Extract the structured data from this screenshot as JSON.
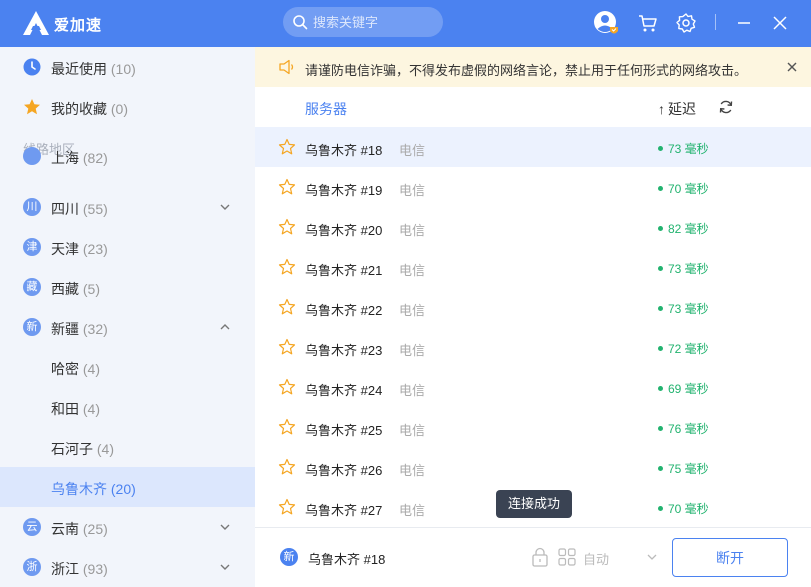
{
  "app": {
    "name": "爱加速"
  },
  "search": {
    "placeholder": "搜索关键字"
  },
  "sidebar": {
    "recent": {
      "label": "最近使用",
      "count": "(10)"
    },
    "favorites": {
      "label": "我的收藏",
      "count": "(0)"
    },
    "section_title": "线路地区",
    "regions": [
      {
        "icon_text": "",
        "label": "上海",
        "count": "(82)"
      },
      {
        "icon_text": "川",
        "label": "四川",
        "count": "(55)"
      },
      {
        "icon_text": "津",
        "label": "天津",
        "count": "(23)"
      },
      {
        "icon_text": "藏",
        "label": "西藏",
        "count": "(5)"
      },
      {
        "icon_text": "新",
        "label": "新疆",
        "count": "(32)"
      },
      {
        "icon_text": "",
        "label": "哈密",
        "count": "(4)"
      },
      {
        "icon_text": "",
        "label": "和田",
        "count": "(4)"
      },
      {
        "icon_text": "",
        "label": "石河子",
        "count": "(4)"
      },
      {
        "icon_text": "",
        "label": "乌鲁木齐",
        "count": "(20)"
      },
      {
        "icon_text": "云",
        "label": "云南",
        "count": "(25)"
      },
      {
        "icon_text": "浙",
        "label": "浙江",
        "count": "(93)"
      }
    ]
  },
  "notice": {
    "text": "请谨防电信诈骗，不得发布虚假的网络言论，禁止用于任何形式的网络攻击。"
  },
  "table": {
    "col_server": "服务器",
    "col_latency": "延迟",
    "latency_arrow": "↑",
    "rows": [
      {
        "name": "乌鲁木齐 #18",
        "isp": "电信",
        "latency": "73 毫秒"
      },
      {
        "name": "乌鲁木齐 #19",
        "isp": "电信",
        "latency": "70 毫秒"
      },
      {
        "name": "乌鲁木齐 #20",
        "isp": "电信",
        "latency": "82 毫秒"
      },
      {
        "name": "乌鲁木齐 #21",
        "isp": "电信",
        "latency": "73 毫秒"
      },
      {
        "name": "乌鲁木齐 #22",
        "isp": "电信",
        "latency": "73 毫秒"
      },
      {
        "name": "乌鲁木齐 #23",
        "isp": "电信",
        "latency": "72 毫秒"
      },
      {
        "name": "乌鲁木齐 #24",
        "isp": "电信",
        "latency": "69 毫秒"
      },
      {
        "name": "乌鲁木齐 #25",
        "isp": "电信",
        "latency": "76 毫秒"
      },
      {
        "name": "乌鲁木齐 #26",
        "isp": "电信",
        "latency": "75 毫秒"
      },
      {
        "name": "乌鲁木齐 #27",
        "isp": "电信",
        "latency": "70 毫秒"
      }
    ]
  },
  "toast": {
    "text": "连接成功"
  },
  "footer": {
    "region_icon_text": "新",
    "current_server": "乌鲁木齐 #18",
    "mode": "自动",
    "disconnect_label": "断开"
  },
  "colors": {
    "accent": "#4b82f0",
    "latency_green": "#22b36f",
    "notice_bg": "#fdf6e0",
    "star": "#f5a623"
  }
}
